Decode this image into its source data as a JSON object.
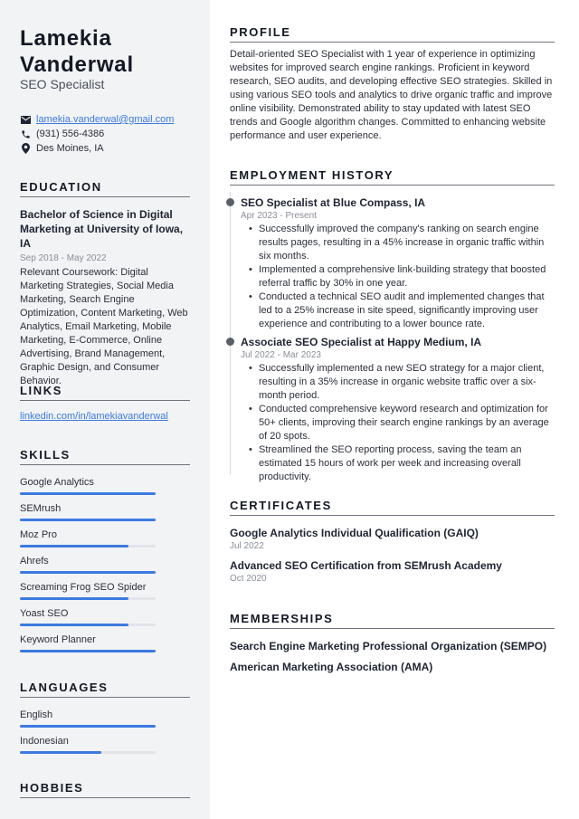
{
  "header": {
    "name": "Lamekia Vanderwal",
    "title": "SEO Specialist"
  },
  "contact": {
    "email": "lamekia.vanderwal@gmail.com",
    "phone": "(931) 556-4386",
    "location": "Des Moines, IA",
    "icons": [
      "envelope-icon",
      "phone-icon",
      "map-pin-icon"
    ]
  },
  "sidebar": {
    "education": {
      "heading": "EDUCATION",
      "degree": "Bachelor of Science in Digital Marketing at University of Iowa, IA",
      "date": "Sep 2018 - May 2022",
      "description": "Relevant Coursework: Digital Marketing Strategies, Social Media Marketing, Search Engine Optimization, Content Marketing, Web Analytics, Email Marketing, Mobile Marketing, E-Commerce, Online Advertising, Brand Management, Graphic Design, and Consumer Behavior."
    },
    "links": {
      "heading": "LINKS",
      "items": [
        "linkedin.com/in/lamekiavanderwal"
      ]
    },
    "skills": {
      "heading": "SKILLS",
      "items": [
        {
          "label": "Google Analytics",
          "level": 1.0
        },
        {
          "label": "SEMrush",
          "level": 1.0
        },
        {
          "label": "Moz Pro",
          "level": 0.8
        },
        {
          "label": "Ahrefs",
          "level": 1.0
        },
        {
          "label": "Screaming Frog SEO Spider",
          "level": 0.8
        },
        {
          "label": "Yoast SEO",
          "level": 0.8
        },
        {
          "label": "Keyword Planner",
          "level": 1.0
        }
      ]
    },
    "languages": {
      "heading": "LANGUAGES",
      "items": [
        {
          "label": "English",
          "level": 1.0
        },
        {
          "label": "Indonesian",
          "level": 0.6
        }
      ]
    },
    "hobbies": {
      "heading": "HOBBIES"
    }
  },
  "main": {
    "profile": {
      "heading": "PROFILE",
      "text": "Detail-oriented SEO Specialist with 1 year of experience in optimizing websites for improved search engine rankings. Proficient in keyword research, SEO audits, and developing effective SEO strategies. Skilled in using various SEO tools and analytics to drive organic traffic and improve online visibility. Demonstrated ability to stay updated with latest SEO trends and Google algorithm changes. Committed to enhancing website performance and user experience."
    },
    "employment": {
      "heading": "EMPLOYMENT HISTORY",
      "jobs": [
        {
          "title": "SEO Specialist at Blue Compass, IA",
          "date": "Apr 2023 - Present",
          "bullets": [
            "Successfully improved the company's ranking on search engine results pages, resulting in a 45% increase in organic traffic within six months.",
            "Implemented a comprehensive link-building strategy that boosted referral traffic by 30% in one year.",
            "Conducted a technical SEO audit and implemented changes that led to a 25% increase in site speed, significantly improving user experience and contributing to a lower bounce rate."
          ]
        },
        {
          "title": "Associate SEO Specialist at Happy Medium, IA",
          "date": "Jul 2022 - Mar 2023",
          "bullets": [
            "Successfully implemented a new SEO strategy for a major client, resulting in a 35% increase in organic website traffic over a six-month period.",
            "Conducted comprehensive keyword research and optimization for 50+ clients, improving their search engine rankings by an average of 20 spots.",
            "Streamlined the SEO reporting process, saving the team an estimated 15 hours of work per week and increasing overall productivity."
          ]
        }
      ]
    },
    "certificates": {
      "heading": "CERTIFICATES",
      "items": [
        {
          "title": "Google Analytics Individual Qualification (GAIQ)",
          "date": "Jul 2022"
        },
        {
          "title": "Advanced SEO Certification from SEMrush Academy",
          "date": "Oct 2020"
        }
      ]
    },
    "memberships": {
      "heading": "MEMBERSHIPS",
      "items": [
        "Search Engine Marketing Professional Organization (SEMPO)",
        "American Marketing Association (AMA)"
      ]
    }
  },
  "colors": {
    "accent": "#3b7ae0",
    "sidebar_bg": "#f2f3f5",
    "text": "#1f2433",
    "muted": "#8a8e97"
  }
}
